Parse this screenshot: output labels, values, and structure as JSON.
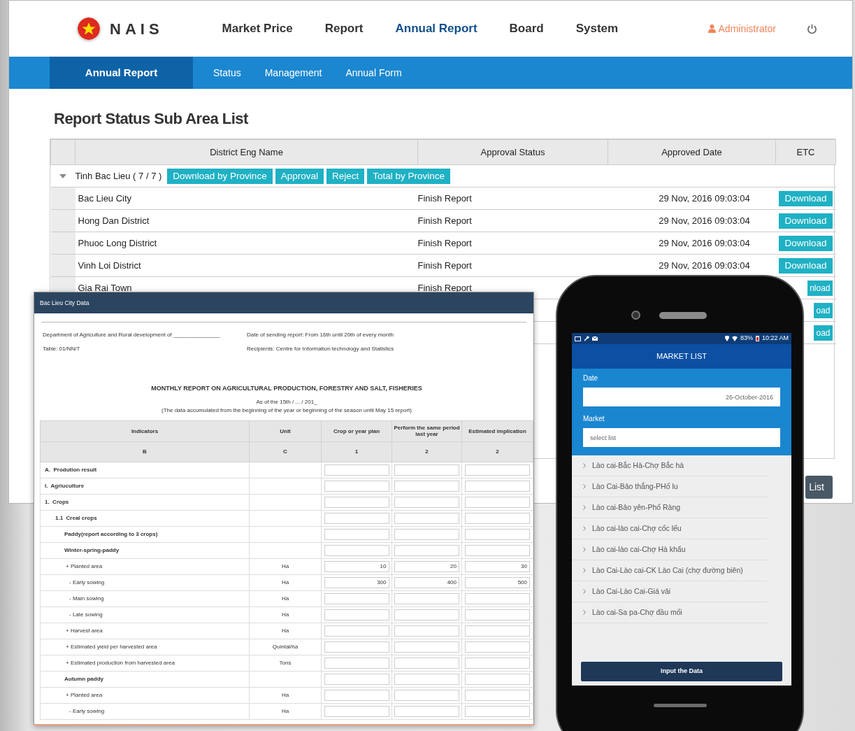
{
  "app": {
    "logo": "NAIS",
    "menu": [
      {
        "label": "Market Price",
        "selected": false
      },
      {
        "label": "Report",
        "selected": false
      },
      {
        "label": "Annual Report",
        "selected": true
      },
      {
        "label": "Board",
        "selected": false
      },
      {
        "label": "System",
        "selected": false
      }
    ],
    "user": "Administrator"
  },
  "subnav": [
    {
      "label": "Annual Report",
      "selected": true
    },
    {
      "label": "Status",
      "selected": false
    },
    {
      "label": "Management",
      "selected": false
    },
    {
      "label": "Annual Form",
      "selected": false
    }
  ],
  "page_title": "Report Status Sub Area List",
  "table": {
    "columns": [
      "District Eng Name",
      "Approval Status",
      "Approved Date",
      "ETC"
    ],
    "group": {
      "name": "Tinh Bac Lieu ( 7 / 7 )",
      "expanded": true,
      "actions": [
        "Download by Province",
        "Approval",
        "Reject",
        "Total by Province"
      ]
    },
    "rows": [
      {
        "district": "Bac Lieu City",
        "status": "Finish Report",
        "date": "29 Nov, 2016 09:03:04",
        "action": "Download"
      },
      {
        "district": "Hong Dan District",
        "status": "Finish Report",
        "date": "29 Nov, 2016 09:03:04",
        "action": "Download"
      },
      {
        "district": "Phuoc Long District",
        "status": "Finish Report",
        "date": "29 Nov, 2016 09:03:04",
        "action": "Download"
      },
      {
        "district": "Vinh Loi District",
        "status": "Finish Report",
        "date": "29 Nov, 2016 09:03:04",
        "action": "Download"
      },
      {
        "district": "Gia Rai Town",
        "status": "Finish Report",
        "action": "nload"
      },
      {
        "action": "oad"
      },
      {
        "action": "oad"
      }
    ]
  },
  "list_button": "List",
  "document": {
    "title": "Bac Lieu City Data",
    "info_left": [
      "Department of Agriculture and Rural development of _______________",
      "Table: 01/NN/T"
    ],
    "info_right": [
      "Date of sending report: From 16th until 20th of every month",
      "Recipients: Centre for Information technology and Statistics"
    ],
    "heading": "MONTHLY REPORT ON AGRICULTURAL PRODUCTION, FORESTRY AND SALT, FISHERIES",
    "subheadings": [
      "As of the 15th / ... / 201_",
      "(The data accumulated from the beginning of the year or beginning of the season until May 15 report)"
    ],
    "columns": [
      {
        "name": "Indicators",
        "code": "B"
      },
      {
        "name": "Unit",
        "code": "C"
      },
      {
        "name": "Crop or year plan",
        "code": "1"
      },
      {
        "name": "Perform the same period last year",
        "code": "2"
      },
      {
        "name": "Estimated implication",
        "code": "2"
      }
    ],
    "indicators": [
      {
        "label": "A.  Prodution result",
        "children": [
          {
            "label": "I.  Agriuculture",
            "children": [
              {
                "label": "1.  Crops",
                "children": [
                  {
                    "label": "1.1  Creal crops",
                    "children": [
                      {
                        "label": "Paddy(report according to 3 crops)",
                        "children": [
                          {
                            "label": "Winter-spring-paddy",
                            "children": [
                              {
                                "label": "+ Planted area",
                                "unit": "Ha",
                                "values": [
                                  "10",
                                  "20",
                                  "30"
                                ],
                                "children": [
                                  {
                                    "label": "- Early sowing",
                                    "unit": "Ha",
                                    "values": [
                                      "300",
                                      "400",
                                      "500"
                                    ]
                                  },
                                  {
                                    "label": "- Main sowing",
                                    "unit": "Ha"
                                  },
                                  {
                                    "label": "- Late sowing",
                                    "unit": "Ha"
                                  }
                                ]
                              },
                              {
                                "label": "+ Harvest area",
                                "unit": "Ha"
                              },
                              {
                                "label": "+ Estimated yield per harvested area",
                                "unit": "Quintal/ha"
                              },
                              {
                                "label": "+ Estimated production from harvested area",
                                "unit": "Tons"
                              }
                            ]
                          },
                          {
                            "label": "Autumn paddy",
                            "children": [
                              {
                                "label": "+ Planted area",
                                "unit": "Ha",
                                "children": [
                                  {
                                    "label": "- Early sowing",
                                    "unit": "Ha"
                                  }
                                ]
                              }
                            ]
                          }
                        ]
                      }
                    ]
                  }
                ]
              }
            ]
          }
        ]
      }
    ]
  },
  "phone": {
    "status": {
      "battery": "83%",
      "time": "10:22 AM"
    },
    "title": "MARKET LIST",
    "date_label": "Date",
    "date_value": "26-October-2016",
    "market_label": "Market",
    "market_placeholder": "select list",
    "markets": [
      "Lào cai-Bắc Hà-Chợ Bắc hà",
      "Lào Cai-Bảo thắng-PHố lu",
      "Lào cai-Bảo yên-Phố Ràng",
      "Lào cai-lào cai-Chợ cốc lếu",
      "Lào cai-lào cai-Chợ Hà khẩu",
      "Lào Cai-Lào cai-CK Lào Cai (chợ đường biên)",
      "Lào Cai-Lào Cai-Giá vải",
      "Lào cai-Sa pa-Chợ đầu mối"
    ],
    "button": "Input the Data"
  }
}
